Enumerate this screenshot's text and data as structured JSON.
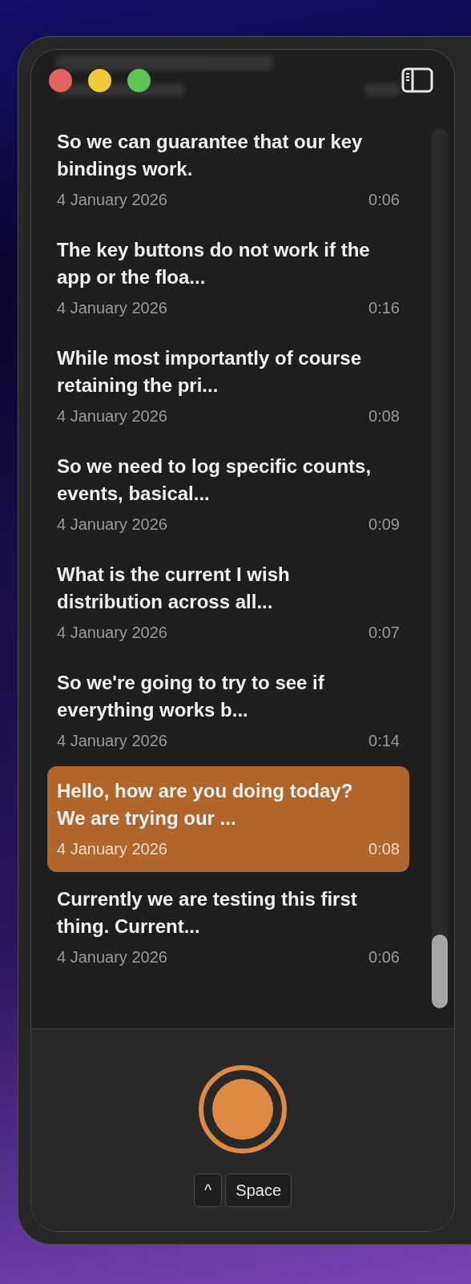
{
  "window": {
    "traffic_lights": [
      {
        "color": "#e5625e"
      },
      {
        "color": "#f3c83a"
      },
      {
        "color": "#5fc454"
      }
    ]
  },
  "recordings": [
    {
      "title": "So we can guarantee that our key bindings work.",
      "date": "4 January 2026",
      "duration": "0:06",
      "selected": false
    },
    {
      "title": "The key buttons do not work if the app or the floa...",
      "date": "4 January 2026",
      "duration": "0:16",
      "selected": false
    },
    {
      "title": "While most importantly of course retaining the pri...",
      "date": "4 January 2026",
      "duration": "0:08",
      "selected": false
    },
    {
      "title": "So we need to log specific counts, events, basical...",
      "date": "4 January 2026",
      "duration": "0:09",
      "selected": false
    },
    {
      "title": "What is the current I wish distribution across all...",
      "date": "4 January 2026",
      "duration": "0:07",
      "selected": false
    },
    {
      "title": "So we're going to try to see if everything works b...",
      "date": "4 January 2026",
      "duration": "0:14",
      "selected": false
    },
    {
      "title": "Hello, how are you doing today? We are trying our ...",
      "date": "4 January 2026",
      "duration": "0:08",
      "selected": true
    },
    {
      "title": "Currently we are testing this first thing. Current...",
      "date": "4 January 2026",
      "duration": "0:06",
      "selected": false
    }
  ],
  "shortcut": {
    "keys": [
      "^",
      "Space"
    ]
  }
}
